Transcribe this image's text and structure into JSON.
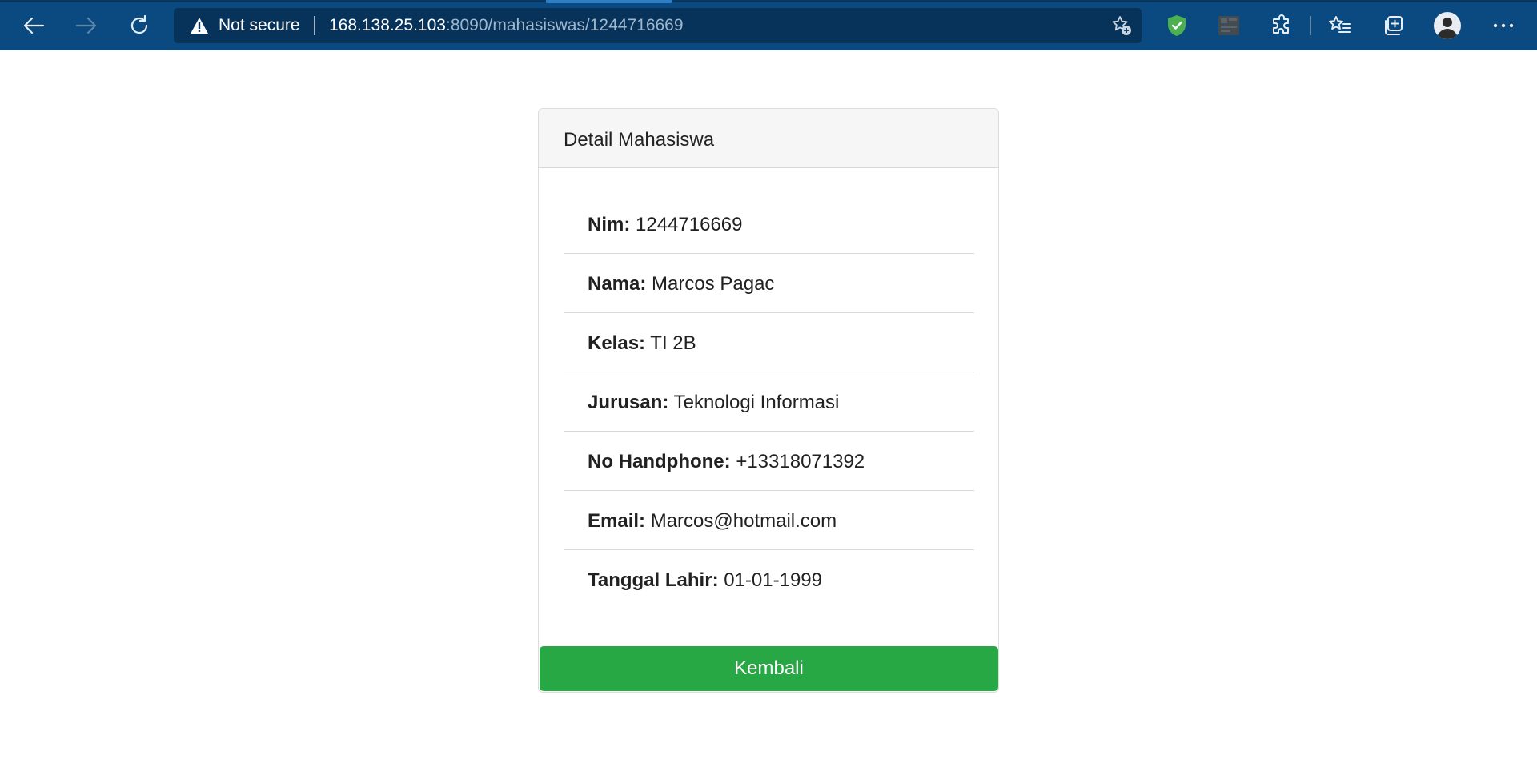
{
  "browser": {
    "security_label": "Not secure",
    "url_host": "168.138.25.103",
    "url_path": ":8090/mahasiswas/1244716669"
  },
  "card": {
    "title": "Detail Mahasiswa",
    "fields": [
      {
        "label": "Nim:",
        "value": "1244716669"
      },
      {
        "label": "Nama:",
        "value": "Marcos Pagac"
      },
      {
        "label": "Kelas:",
        "value": "TI 2B"
      },
      {
        "label": "Jurusan:",
        "value": "Teknologi Informasi"
      },
      {
        "label": "No Handphone:",
        "value": "+13318071392"
      },
      {
        "label": "Email:",
        "value": "Marcos@hotmail.com"
      },
      {
        "label": "Tanggal Lahir:",
        "value": "01-01-1999"
      }
    ]
  },
  "actions": {
    "back_label": "Kembali"
  },
  "colors": {
    "chrome_bg": "#0b4a80",
    "omnibox_bg": "#07335a",
    "success": "#28a745"
  },
  "icons": {
    "back": "arrow-left-icon",
    "forward": "arrow-right-icon",
    "refresh": "refresh-icon",
    "warning": "warning-triangle-icon",
    "favorite_add": "star-plus-icon",
    "shield": "shield-check-icon",
    "extension_tile": "extension-tile-icon",
    "extensions": "puzzle-icon",
    "favorites": "favorites-icon",
    "collections": "collections-icon",
    "profile": "avatar-icon",
    "menu": "more-dots-icon"
  }
}
